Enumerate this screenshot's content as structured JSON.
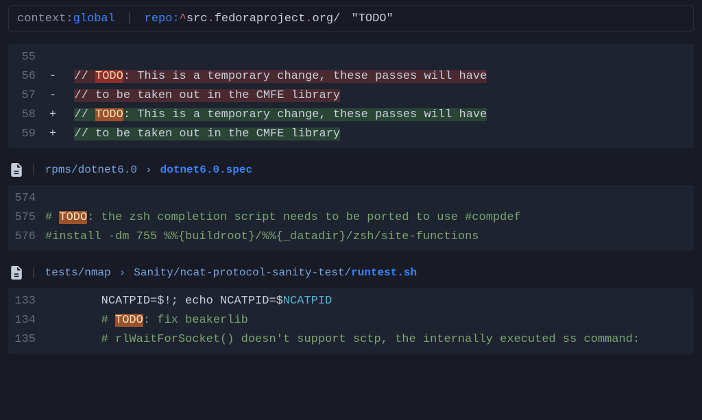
{
  "search": {
    "context_key": "context",
    "context_val": "global",
    "repo_key": "repo",
    "caret": "^",
    "host_p1": "src",
    "host_p2": "fedoraproject",
    "host_p3": "org",
    "slash": "/",
    "query": "\"TODO\""
  },
  "block1": {
    "lines": [
      {
        "ln": "55"
      },
      {
        "ln": "56",
        "g": "-",
        "cls": "del",
        "pre": "  ",
        "a": "// ",
        "todo": "TODO",
        "b": ": This is a temporary change, these passes will have"
      },
      {
        "ln": "57",
        "g": "-",
        "cls": "del",
        "pre": "  ",
        "a": "// to be taken out in the CMFE library"
      },
      {
        "ln": "58",
        "g": "+",
        "cls": "add",
        "pre": "  ",
        "a": "// ",
        "todo": "TODO",
        "b": ": This is a temporary change, these passes will have"
      },
      {
        "ln": "59",
        "g": "+",
        "cls": "add",
        "pre": "  ",
        "a": "// to be taken out in the CMFE library"
      }
    ]
  },
  "file1": {
    "dim": "rpms/dotnet6.0",
    "bold": "dotnet6.0.spec"
  },
  "block2": {
    "lines": [
      {
        "ln": "574",
        "text": ""
      },
      {
        "ln": "575",
        "pre": "# ",
        "todo": "TODO",
        "after": ": the zsh completion script needs to be ported to use #compdef"
      },
      {
        "ln": "576",
        "text": "#install -dm 755 %%{buildroot}/%%{_datadir}/zsh/site-functions"
      }
    ]
  },
  "file2": {
    "dim": "tests/nmap",
    "mid": "Sanity/ncat-protocol-sanity-test/",
    "bold": "runtest.sh"
  },
  "block3": {
    "lines": [
      {
        "ln": "133",
        "indent": "        ",
        "var": "NCATPID=$!; echo NCATPID=$",
        "ref": "NCATPID"
      },
      {
        "ln": "134",
        "indent": "        ",
        "pre": "# ",
        "todo": "TODO",
        "after": ": fix beakerlib"
      },
      {
        "ln": "135",
        "indent": "        ",
        "text": "# rlWaitForSocket() doesn't support sctp, the internally executed ss command:"
      }
    ]
  }
}
